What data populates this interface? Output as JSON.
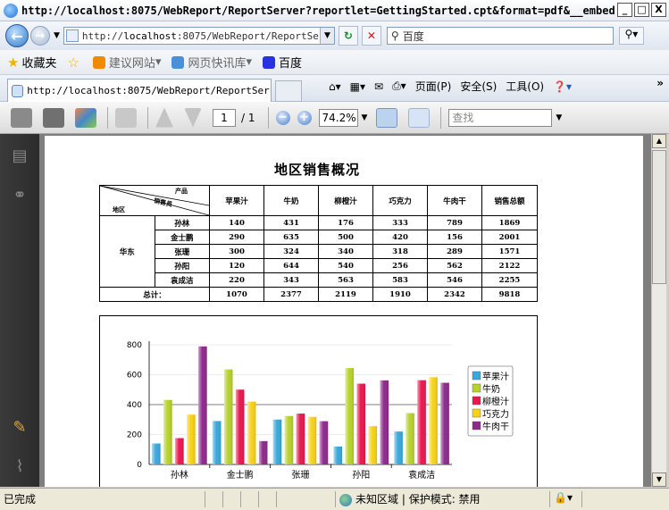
{
  "window": {
    "title": "http://localhost:8075/WebReport/ReportServer?reportlet=GettingStarted.cpt&format=pdf&__embed...",
    "buttons": [
      "_",
      "□",
      "X"
    ]
  },
  "address": {
    "url_prefix": "http://",
    "url_host": "localhost",
    "url_rest": ":8075/WebReport/ReportServer",
    "search_placeholder": "百度"
  },
  "favorites": {
    "label": "收藏夹",
    "items": [
      "建议网站",
      "网页快讯库",
      "百度"
    ]
  },
  "tab": {
    "title": "http://localhost:8075/WebReport/ReportSer..."
  },
  "commands": {
    "page": "页面(P)",
    "safety": "安全(S)",
    "tools": "工具(O)",
    "more": "»"
  },
  "pdf_toolbar": {
    "page_current": "1",
    "page_total": "/ 1",
    "zoom": "74.2%",
    "find_placeholder": "查找"
  },
  "report": {
    "title": "地区销售概况",
    "header_corner": {
      "product": "产品",
      "salesperson": "销售员",
      "region": "地区"
    },
    "columns": [
      "苹果汁",
      "牛奶",
      "柳橙汁",
      "巧克力",
      "牛肉干",
      "销售总额"
    ],
    "region": "华东",
    "rows": [
      {
        "name": "孙林",
        "values": [
          "140",
          "431",
          "176",
          "333",
          "789",
          "1869"
        ]
      },
      {
        "name": "金士鹏",
        "values": [
          "290",
          "635",
          "500",
          "420",
          "156",
          "2001"
        ]
      },
      {
        "name": "张珊",
        "values": [
          "300",
          "324",
          "340",
          "318",
          "289",
          "1571"
        ]
      },
      {
        "name": "孙阳",
        "values": [
          "120",
          "644",
          "540",
          "256",
          "562",
          "2122"
        ]
      },
      {
        "name": "袁成洁",
        "values": [
          "220",
          "343",
          "563",
          "583",
          "546",
          "2255"
        ]
      }
    ],
    "total_label": "总计：",
    "totals": [
      "1070",
      "2377",
      "2119",
      "1910",
      "2342",
      "9818"
    ]
  },
  "chart_data": {
    "type": "bar",
    "categories": [
      "孙林",
      "金士鹏",
      "张珊",
      "孙阳",
      "袁成洁"
    ],
    "series": [
      {
        "name": "苹果汁",
        "values": [
          140,
          290,
          300,
          120,
          220
        ]
      },
      {
        "name": "牛奶",
        "values": [
          431,
          635,
          324,
          644,
          343
        ]
      },
      {
        "name": "柳橙汁",
        "values": [
          176,
          500,
          340,
          540,
          563
        ]
      },
      {
        "name": "巧克力",
        "values": [
          333,
          420,
          318,
          256,
          583
        ]
      },
      {
        "name": "牛肉干",
        "values": [
          789,
          156,
          289,
          562,
          546
        ]
      }
    ],
    "colors": [
      "#3aa8dc",
      "#b8d22b",
      "#e8184e",
      "#f7d218",
      "#8e2a8c"
    ],
    "yticks": [
      0,
      200,
      400,
      600,
      800
    ],
    "ylim": [
      0,
      800
    ],
    "legend": "right",
    "grid": true
  },
  "status": {
    "text": "已完成",
    "zone": "未知区域",
    "protected": "保护模式: 禁用"
  }
}
